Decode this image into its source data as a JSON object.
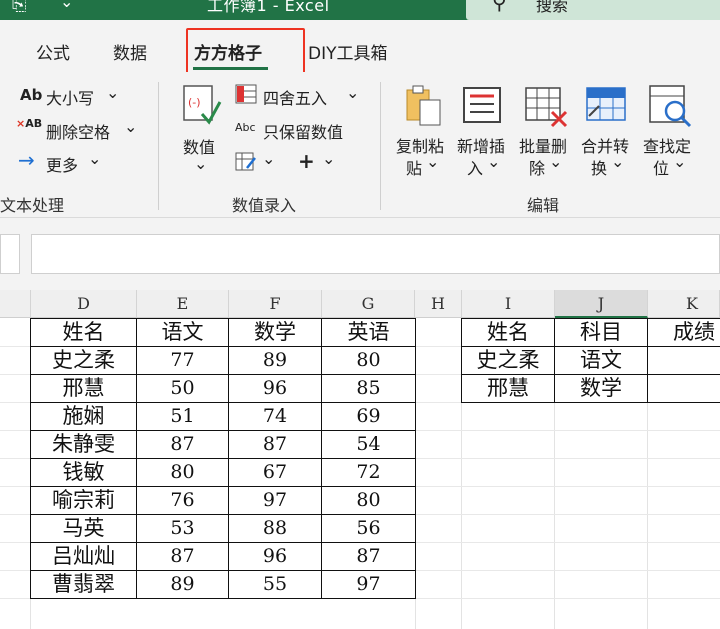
{
  "titlebar": {
    "title": "工作簿1 - Excel",
    "search_placeholder": "搜索"
  },
  "tabs": [
    {
      "label": "公式"
    },
    {
      "label": "数据"
    },
    {
      "label": "方方格子",
      "active": true
    },
    {
      "label": "DIY工具箱"
    }
  ],
  "ribbon": {
    "text_group": {
      "case_label": "大小写",
      "remove_spaces_label": "删除空格",
      "more_label": "更多",
      "group_label": "文本处理"
    },
    "numeric_group": {
      "value_label": "数值",
      "round_label": "四舍五入",
      "keep_value_label": "只保留数值",
      "group_label": "数值录入"
    },
    "edit_group": {
      "buttons": [
        {
          "line1": "复制粘",
          "line2": "贴"
        },
        {
          "line1": "新增插",
          "line2": "入"
        },
        {
          "line1": "批量删",
          "line2": "除"
        },
        {
          "line1": "合并转",
          "line2": "换"
        },
        {
          "line1": "查找定",
          "line2": "位"
        }
      ],
      "group_label": "编辑"
    }
  },
  "formula_bar": {
    "name_box": "",
    "value": ""
  },
  "sheet": {
    "columns": [
      "D",
      "E",
      "F",
      "G",
      "H",
      "I",
      "J",
      "K"
    ],
    "main_table": {
      "headers": [
        "姓名",
        "语文",
        "数学",
        "英语"
      ],
      "rows": [
        [
          "史之柔",
          "77",
          "89",
          "80"
        ],
        [
          "邢慧",
          "50",
          "96",
          "85"
        ],
        [
          "施娴",
          "51",
          "74",
          "69"
        ],
        [
          "朱静雯",
          "87",
          "87",
          "54"
        ],
        [
          "钱敏",
          "80",
          "67",
          "72"
        ],
        [
          "喻宗莉",
          "76",
          "97",
          "80"
        ],
        [
          "马英",
          "53",
          "88",
          "56"
        ],
        [
          "吕灿灿",
          "87",
          "96",
          "87"
        ],
        [
          "曹翡翠",
          "89",
          "55",
          "97"
        ]
      ]
    },
    "lookup_table": {
      "headers": [
        "姓名",
        "科目",
        "成绩"
      ],
      "rows": [
        [
          "史之柔",
          "语文",
          ""
        ],
        [
          "邢慧",
          "数学",
          ""
        ]
      ]
    }
  },
  "colors": {
    "accent": "#217346",
    "highlight": "#e33322"
  }
}
